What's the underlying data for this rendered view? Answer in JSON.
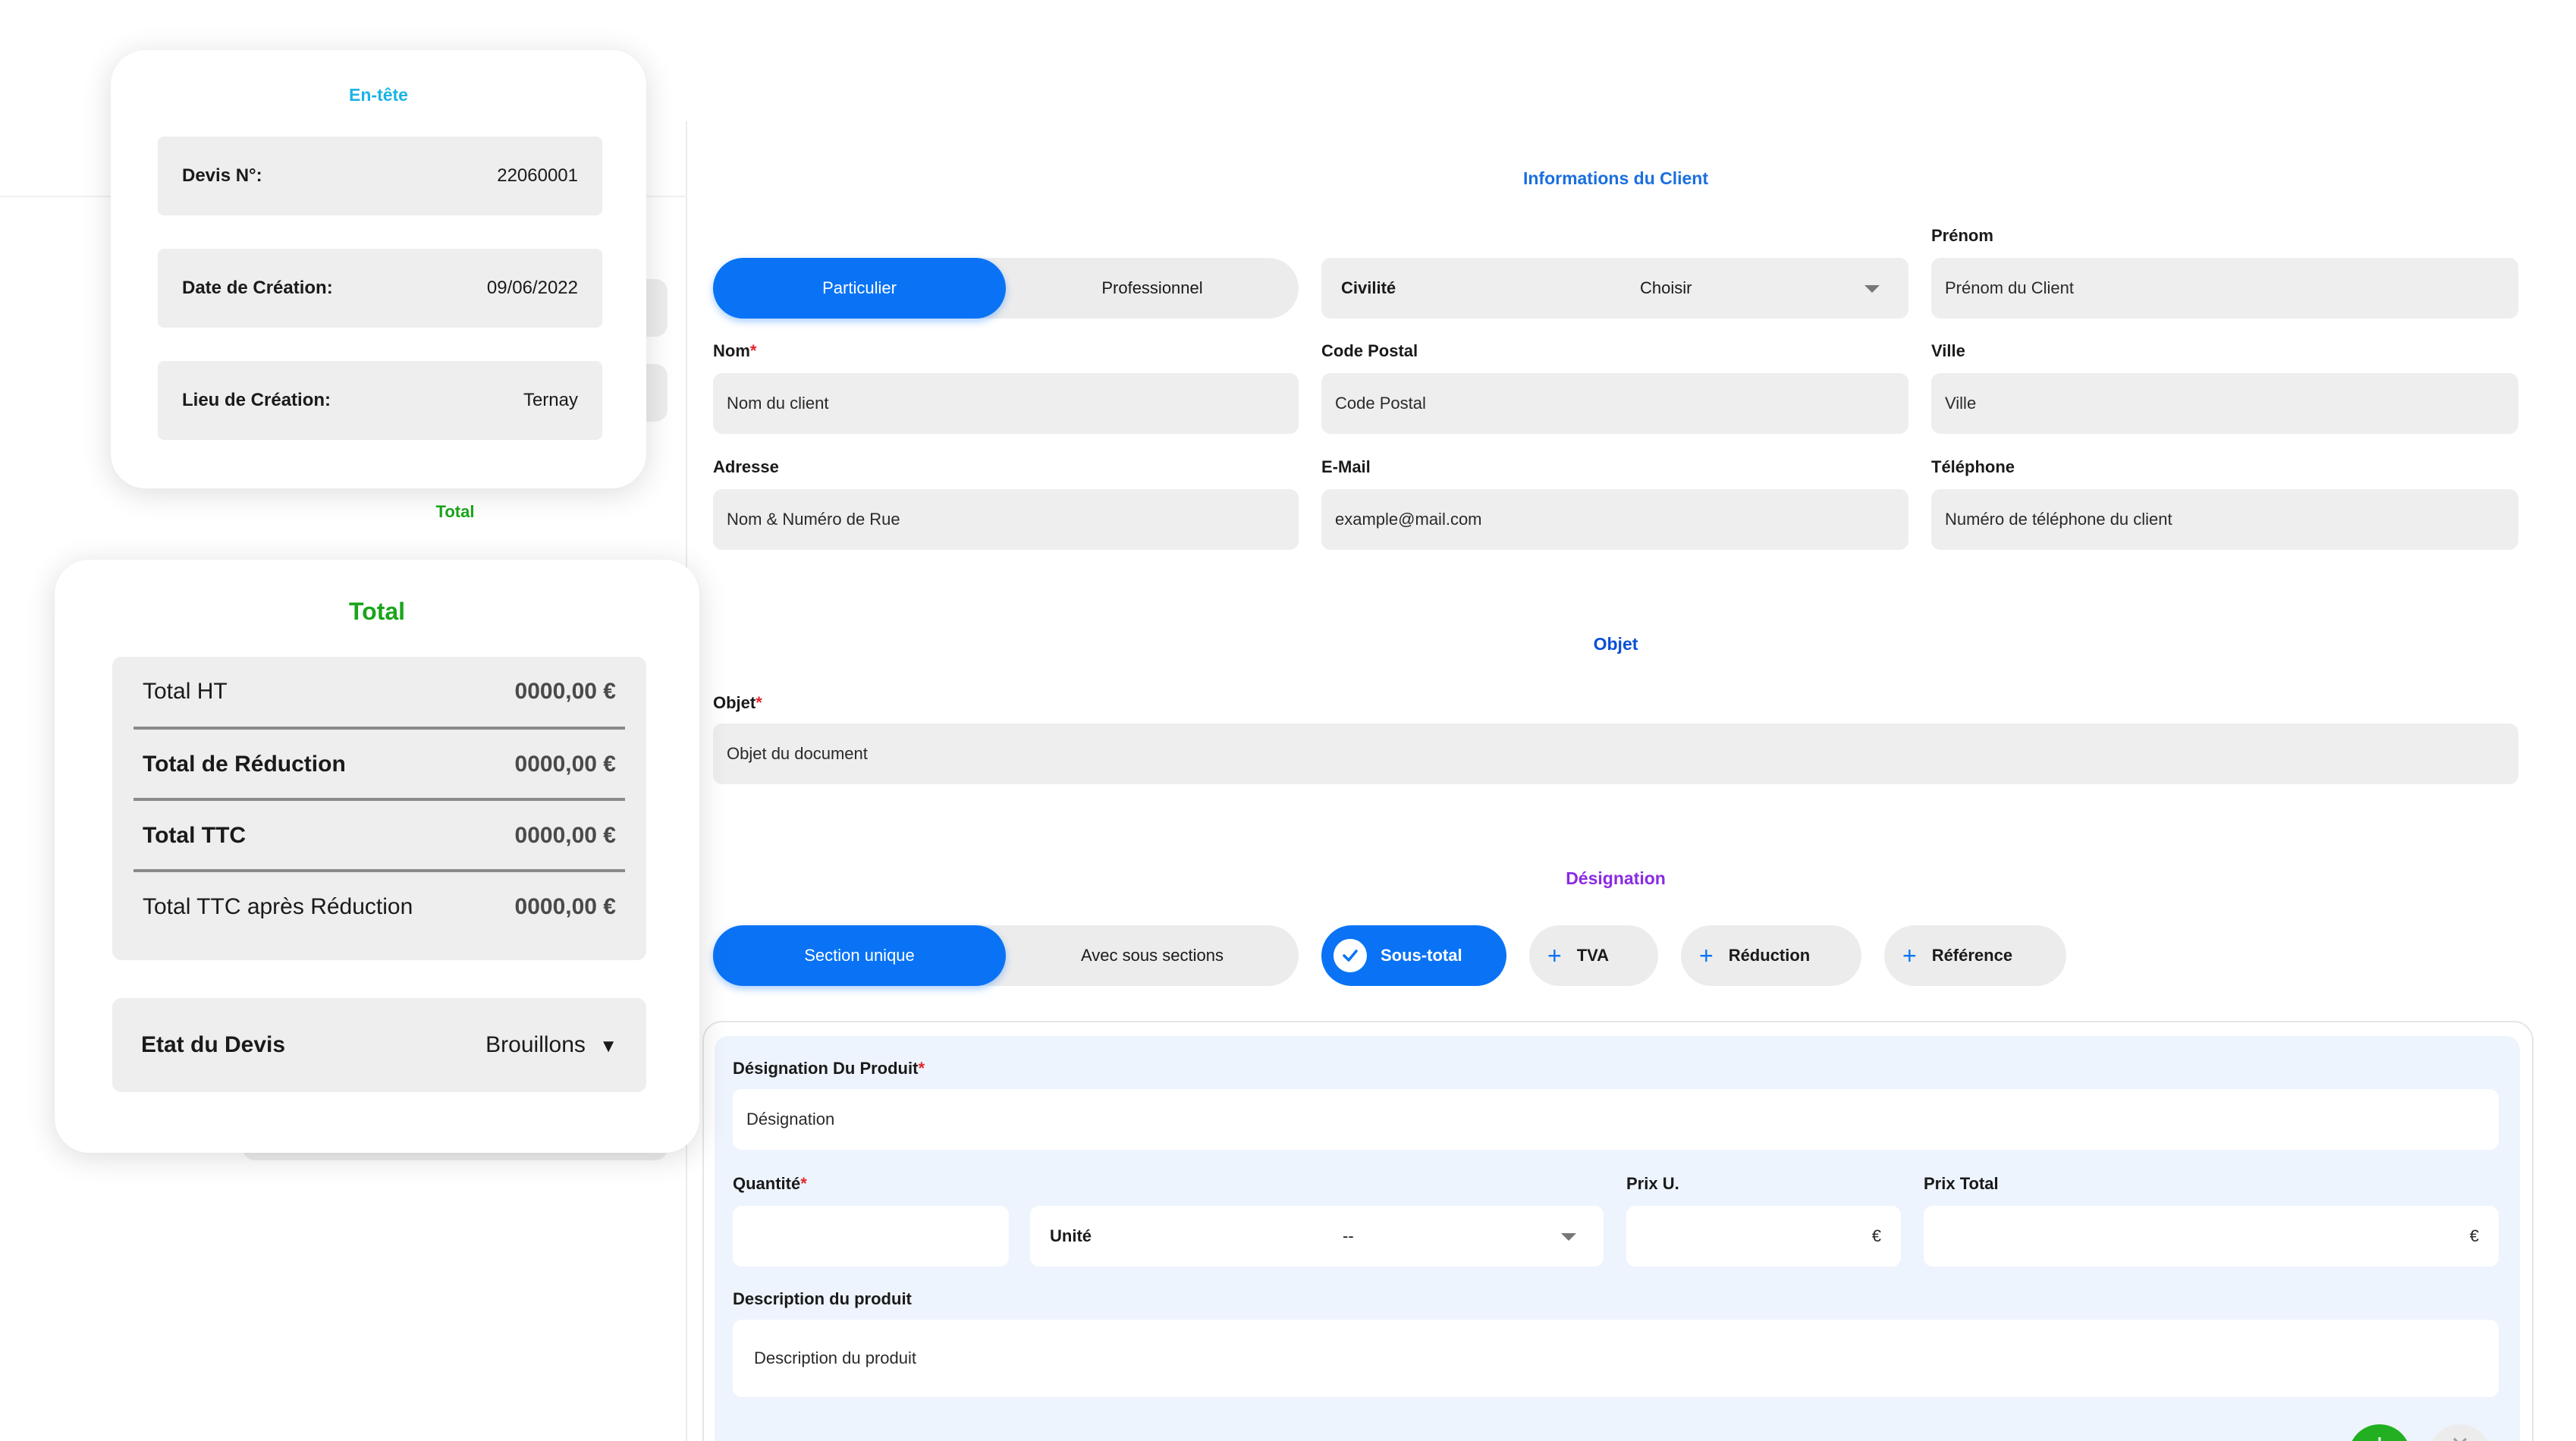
{
  "header_card": {
    "title": "En-tête",
    "rows": [
      {
        "label": "Devis N°:",
        "value": "22060001"
      },
      {
        "label": "Date de Création:",
        "value": "09/06/2022"
      },
      {
        "label": "Lieu de Création:",
        "value": "Ternay"
      }
    ]
  },
  "background_total_label": "Total",
  "total_card": {
    "title": "Total",
    "rows": [
      {
        "label": "Total HT",
        "value": "0000,00 €"
      },
      {
        "label": "Total de Réduction",
        "value": "0000,00 €"
      },
      {
        "label": "Total TTC",
        "value": "0000,00 €"
      },
      {
        "label": "Total TTC après Réduction",
        "value": "0000,00 €"
      }
    ],
    "status_label": "Etat du Devis",
    "status_value": "Brouillons",
    "status_caret": "▼"
  },
  "client": {
    "title": "Informations du Client",
    "type_options": [
      "Particulier",
      "Professionnel"
    ],
    "type_selected": "Particulier",
    "civilite": {
      "label": "Civilité",
      "value": "Choisir"
    },
    "prenom": {
      "label": "Prénom",
      "placeholder": "Prénom du Client"
    },
    "nom": {
      "label": "Nom",
      "required": "*",
      "placeholder": "Nom du client"
    },
    "code_postal": {
      "label": "Code Postal",
      "placeholder": "Code Postal"
    },
    "ville": {
      "label": "Ville",
      "placeholder": "Ville"
    },
    "adresse": {
      "label": "Adresse",
      "placeholder": "Nom & Numéro de Rue"
    },
    "email": {
      "label": "E-Mail",
      "placeholder": "example@mail.com"
    },
    "telephone": {
      "label": "Téléphone",
      "placeholder": "Numéro de téléphone du client"
    }
  },
  "objet": {
    "title": "Objet",
    "label": "Objet",
    "required": "*",
    "placeholder": "Objet du document"
  },
  "designation": {
    "title": "Désignation",
    "section_options": [
      "Section unique",
      "Avec sous sections"
    ],
    "section_selected": "Section unique",
    "chips": {
      "sous_total": "Sous-total",
      "tva": "TVA",
      "reduction": "Réduction",
      "reference": "Référence"
    },
    "product": {
      "designation_label": "Désignation Du Produit",
      "designation_required": "*",
      "designation_placeholder": "Désignation",
      "quantite_label": "Quantité",
      "quantite_required": "*",
      "unite_label": "Unité",
      "unite_value": "--",
      "prix_u_label": "Prix U.",
      "prix_u_currency": "€",
      "prix_total_label": "Prix Total",
      "prix_total_currency": "€",
      "description_label": "Description du produit",
      "description_placeholder": "Description du produit"
    },
    "add_symbol": "+",
    "remove_symbol": "×"
  },
  "colors": {
    "accent_blue": "#0a73f5",
    "header_cyan": "#1ab3e6",
    "client_title_blue": "#1a6fe0",
    "objet_title_blue": "#0a4fd6",
    "designation_purple": "#8a2be2",
    "total_green": "#1aa51a",
    "required_red": "#e0262e"
  }
}
